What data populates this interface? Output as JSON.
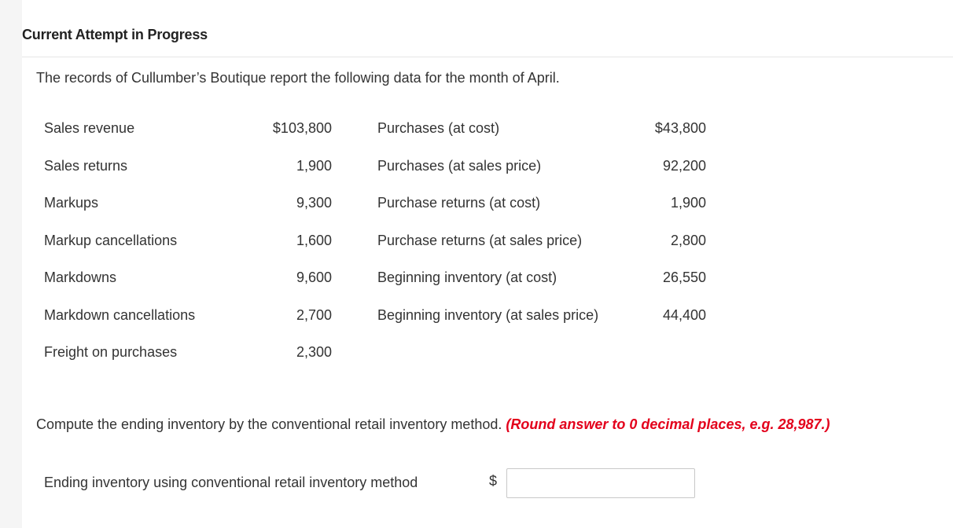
{
  "header": {
    "title": "Current Attempt in Progress"
  },
  "intro": "The records of Cullumber’s Boutique report the following data for the month of April.",
  "rows": [
    {
      "label1": "Sales revenue",
      "value1": "$103,800",
      "label2": "Purchases (at cost)",
      "value2": "$43,800"
    },
    {
      "label1": "Sales returns",
      "value1": "1,900",
      "label2": "Purchases (at sales price)",
      "value2": "92,200"
    },
    {
      "label1": "Markups",
      "value1": "9,300",
      "label2": "Purchase returns (at cost)",
      "value2": "1,900"
    },
    {
      "label1": "Markup cancellations",
      "value1": "1,600",
      "label2": "Purchase returns (at sales price)",
      "value2": "2,800"
    },
    {
      "label1": "Markdowns",
      "value1": "9,600",
      "label2": "Beginning inventory (at cost)",
      "value2": "26,550"
    },
    {
      "label1": "Markdown cancellations",
      "value1": "2,700",
      "label2": "Beginning inventory (at sales price)",
      "value2": "44,400"
    },
    {
      "label1": "Freight on purchases",
      "value1": "2,300",
      "label2": "",
      "value2": ""
    }
  ],
  "question": {
    "text": "Compute the ending inventory by the conventional retail inventory method.",
    "instruction": "(Round answer to 0 decimal places, e.g. 28,987.)"
  },
  "answer": {
    "label": "Ending inventory using conventional retail inventory method",
    "currency": "$",
    "value": "",
    "placeholder": ""
  }
}
